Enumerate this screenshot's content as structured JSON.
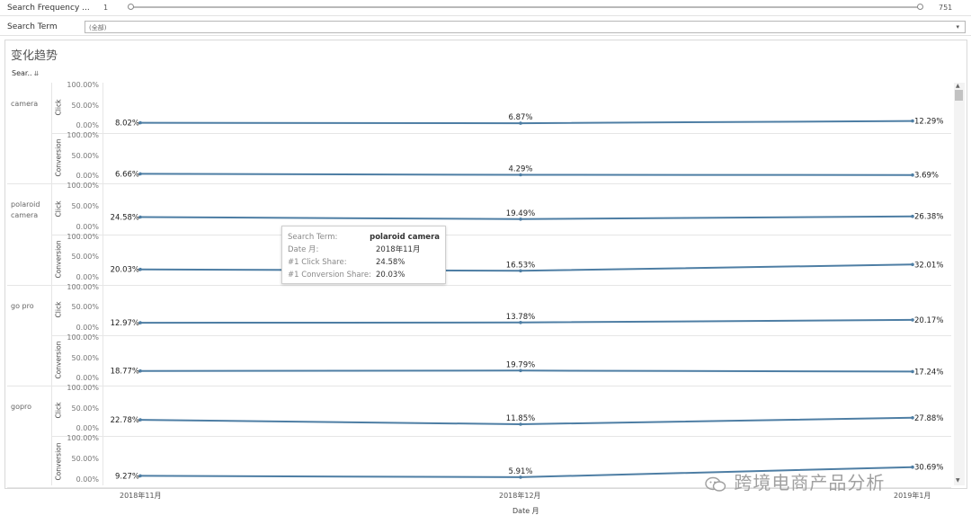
{
  "filters": {
    "frequency": {
      "label": "Search Frequency ...",
      "min": "1",
      "max": "751"
    },
    "term": {
      "label": "Search Term",
      "value": "(全部)",
      "arrow": "▾"
    }
  },
  "sheet": {
    "title": "变化趋势",
    "column_header": "Sear..",
    "column_header_icon": "⇊",
    "x_axis_title": "Date 月",
    "ticks": [
      "100.00%",
      "50.00%",
      "0.00%"
    ]
  },
  "chart_data": {
    "type": "line",
    "x": [
      "2018年11月",
      "2018年12月",
      "2019年1月"
    ],
    "xlabel": "Date 月",
    "ylim": [
      0,
      100
    ],
    "y_unit": "%",
    "rows": [
      {
        "term": "camera",
        "measure": "Click",
        "values": [
          8.02,
          6.87,
          12.29
        ],
        "labels": [
          "8.02%",
          "6.87%",
          "12.29%"
        ]
      },
      {
        "term": "camera",
        "measure": "Conversion",
        "values": [
          6.66,
          4.29,
          3.69
        ],
        "labels": [
          "6.66%",
          "4.29%",
          "3.69%"
        ]
      },
      {
        "term": "polaroid camera",
        "measure": "Click",
        "values": [
          24.58,
          19.49,
          26.38
        ],
        "labels": [
          "24.58%",
          "19.49%",
          "26.38%"
        ]
      },
      {
        "term": "polaroid camera",
        "measure": "Conversion",
        "values": [
          20.03,
          16.53,
          32.01
        ],
        "labels": [
          "20.03%",
          "16.53%",
          "32.01%"
        ]
      },
      {
        "term": "go pro",
        "measure": "Click",
        "values": [
          12.97,
          13.78,
          20.17
        ],
        "labels": [
          "12.97%",
          "13.78%",
          "20.17%"
        ]
      },
      {
        "term": "go pro",
        "measure": "Conversion",
        "values": [
          18.77,
          19.79,
          17.24
        ],
        "labels": [
          "18.77%",
          "19.79%",
          "17.24%"
        ]
      },
      {
        "term": "gopro",
        "measure": "Click",
        "values": [
          22.78,
          11.85,
          27.88
        ],
        "labels": [
          "22.78%",
          "11.85%",
          "27.88%"
        ]
      },
      {
        "term": "gopro",
        "measure": "Conversion",
        "values": [
          9.27,
          5.91,
          30.69
        ],
        "labels": [
          "9.27%",
          "5.91%",
          "30.69%"
        ]
      }
    ],
    "line_color": "#4e7ea4"
  },
  "terms": [
    {
      "name": "camera"
    },
    {
      "name": "polaroid camera"
    },
    {
      "name": "go pro"
    },
    {
      "name": "gopro"
    }
  ],
  "tooltip": {
    "term_key": "Search Term:",
    "term_val": "polaroid camera",
    "date_key": "Date 月:",
    "date_val": "2018年11月",
    "click_key": "#1 Click Share:",
    "click_val": "24.58%",
    "conv_key": "#1 Conversion Share:",
    "conv_val": "20.03%"
  },
  "watermark": {
    "text": "跨境电商产品分析",
    "icon": "wechat-icon"
  },
  "scroll": {
    "up": "▲",
    "down": "▼"
  }
}
